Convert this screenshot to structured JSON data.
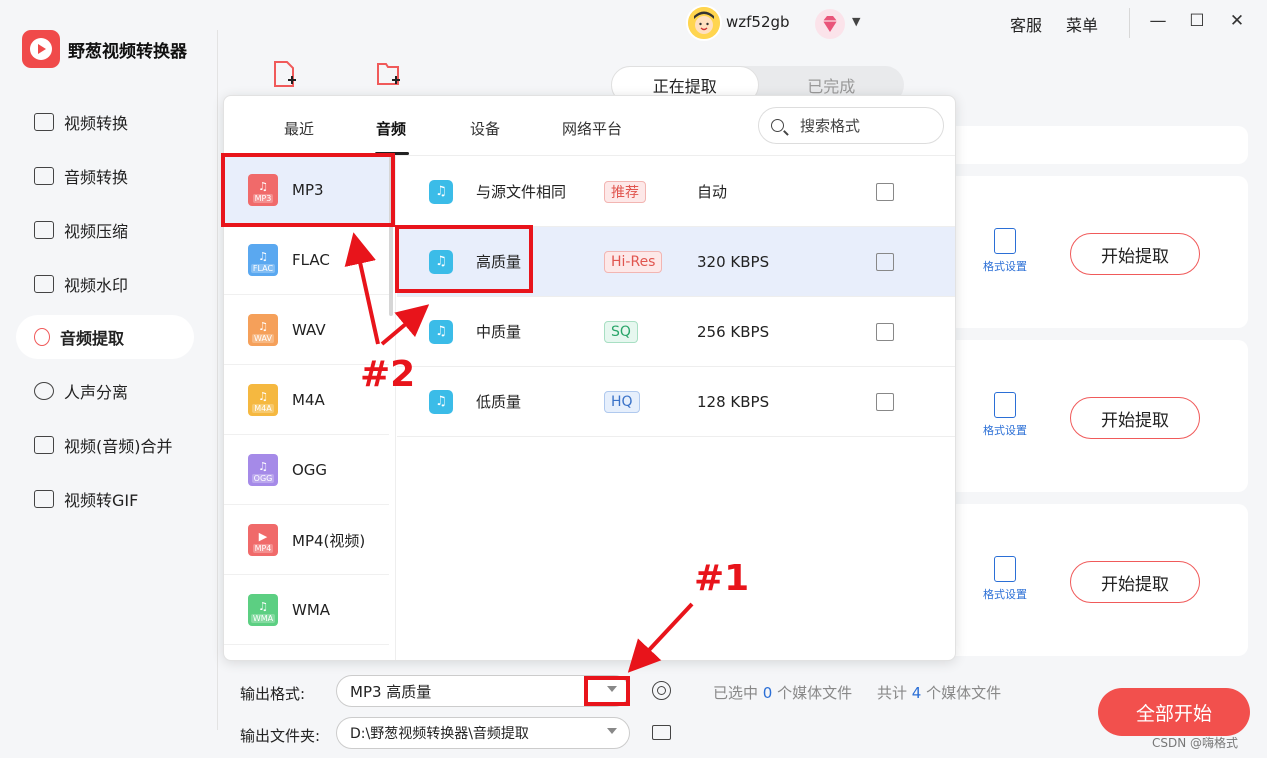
{
  "app": {
    "name": "野葱视频转换器",
    "username": "wzf52gb",
    "nav_service": "客服",
    "nav_menu": "菜单"
  },
  "sidebar": {
    "items": [
      {
        "label": "视频转换",
        "icon": "video-convert-icon"
      },
      {
        "label": "音频转换",
        "icon": "audio-convert-icon"
      },
      {
        "label": "视频压缩",
        "icon": "video-compress-icon"
      },
      {
        "label": "视频水印",
        "icon": "watermark-icon"
      },
      {
        "label": "音频提取",
        "icon": "microphone-icon",
        "active": true
      },
      {
        "label": "人声分离",
        "icon": "vocal-separate-icon"
      },
      {
        "label": "视频(音频)合并",
        "icon": "merge-icon"
      },
      {
        "label": "视频转GIF",
        "icon": "gif-icon"
      }
    ]
  },
  "main": {
    "tab_extracting": "正在提取",
    "tab_done": "已完成",
    "format_settings": "格式设置",
    "start_extract": "开始提取"
  },
  "popup": {
    "tabs": [
      "最近",
      "音频",
      "设备",
      "网络平台"
    ],
    "search_placeholder": "搜索格式",
    "formats": [
      {
        "name": "MP3",
        "tag": "MP3",
        "color": "#f06a6a"
      },
      {
        "name": "FLAC",
        "tag": "FLAC",
        "color": "#5aa8f0"
      },
      {
        "name": "WAV",
        "tag": "WAV",
        "color": "#f5a05a"
      },
      {
        "name": "M4A",
        "tag": "M4A",
        "color": "#f5b840"
      },
      {
        "name": "OGG",
        "tag": "OGG",
        "color": "#a58ae8"
      },
      {
        "name": "MP4(视频)",
        "tag": "MP4",
        "color": "#f06a6a"
      },
      {
        "name": "WMA",
        "tag": "WMA",
        "color": "#5ccf82"
      }
    ],
    "qualities": [
      {
        "name": "与源文件相同",
        "badge": "推荐",
        "badge_style": "red",
        "bitrate": "自动"
      },
      {
        "name": "高质量",
        "badge": "Hi-Res",
        "badge_style": "red",
        "bitrate": "320 KBPS"
      },
      {
        "name": "中质量",
        "badge": "SQ",
        "badge_style": "green",
        "bitrate": "256 KBPS"
      },
      {
        "name": "低质量",
        "badge": "HQ",
        "badge_style": "blue",
        "bitrate": "128 KBPS"
      }
    ]
  },
  "bottom": {
    "output_format_label": "输出格式:",
    "output_format_value": "MP3 高质量",
    "output_folder_label": "输出文件夹:",
    "output_folder_value": "D:\\野葱视频转换器\\音频提取",
    "selected_prefix": "已选中",
    "selected_count": "0",
    "selected_suffix": "个媒体文件",
    "total_prefix": "共计",
    "total_count": "4",
    "total_suffix": "个媒体文件",
    "start_all": "全部开始"
  },
  "annotations": {
    "one": "#1",
    "two": "#2"
  },
  "watermark": "CSDN @嗨格式"
}
